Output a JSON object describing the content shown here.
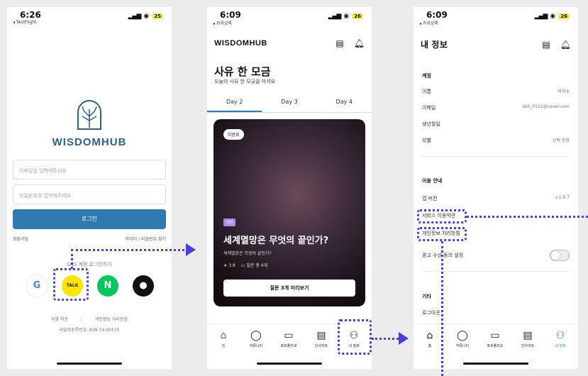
{
  "screen1": {
    "time": "6:26",
    "back": "◂ TestFlight",
    "battery": "25",
    "logo": "WISDOMHUB",
    "email_placeholder": "이메일을 입력해주세요",
    "password_placeholder": "비밀번호를 입력해주세요",
    "login_label": "로그인",
    "signup": "회원가입",
    "find": "아이디 / 비밀번호 찾기",
    "sns_label": "SNS 계정 로그인하기",
    "terms": "이용 약관",
    "privacy": "개인정보 처리방침",
    "biz": "사업자등록번호: 838-74-00575",
    "sns_buttons": [
      "G",
      "TALK",
      "N",
      ""
    ]
  },
  "screen2": {
    "time": "6:09",
    "back": "◂ 카카오톡",
    "battery": "26",
    "brand": "WISDOMHUB",
    "title": "사유 한 모금",
    "subtitle": "오늘의 사유 한 모금을 마셔요",
    "tabs": [
      "Day 2",
      "Day 3",
      "Day 4"
    ],
    "card": {
      "badge": "미완료",
      "tag": "자연",
      "title": "세계멸망은 무엇의 끝인가?",
      "subtitle": "세계멸망은 무엇의 끝인가?",
      "rating": "3.8",
      "questions": "질문 총 4개",
      "button": "질문 3개 미리보기"
    }
  },
  "screen3": {
    "time": "6:09",
    "back": "◂ 카카오톡",
    "battery": "26",
    "title": "내 정보",
    "account_header": "계정",
    "rows": [
      {
        "label": "이름",
        "value": "박지수"
      },
      {
        "label": "이메일",
        "value": "doh_0112@naver.com"
      },
      {
        "label": "생년월일",
        "value": ""
      },
      {
        "label": "성별",
        "value": "선택 안함"
      }
    ],
    "guide_header": "이용 안내",
    "version_label": "앱 버전",
    "version_value": "v.1.5.7",
    "terms": "서비스 이용약관",
    "privacy": "개인정보 처리방침",
    "ads": "광고 수신 동의 설정",
    "etc_header": "기타",
    "logout": "로그아웃"
  },
  "nav": [
    "홈",
    "커뮤니티",
    "포트폴리오",
    "인사이트",
    "내 정보"
  ],
  "colors": {
    "accent": "#2f7ab0",
    "annotation": "#4a3ee0"
  }
}
